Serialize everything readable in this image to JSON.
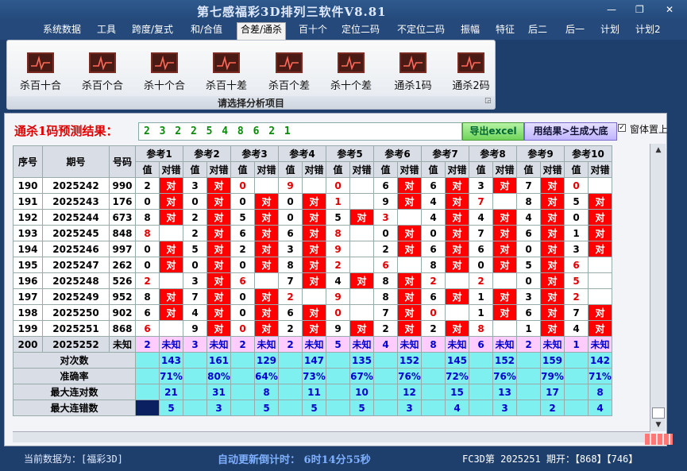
{
  "app": {
    "title": "第七感福彩3D排列三软件V8.81"
  },
  "menu": [
    "系统数据",
    "工具",
    "跨度/复式",
    "和/合值",
    "合差/通杀",
    "百十个",
    "定位二码",
    "不定位二码",
    "振幅",
    "特征",
    "后二",
    "后一",
    "计划",
    "计划2"
  ],
  "ribbon": {
    "buttons": [
      "杀百十合",
      "杀百个合",
      "杀十个合",
      "杀百十差",
      "杀百个差",
      "杀十个差",
      "通杀1码",
      "通杀2码"
    ],
    "caption": "请选择分析项目"
  },
  "prediction": {
    "label": "通杀1码预测结果：",
    "value": "2 3 2 2 5 4 8 6 2 1",
    "export_button": "导出excel",
    "result_button": "用结果>生成大底",
    "topmost_label": "窗体置上"
  },
  "table": {
    "headers": {
      "seq": "序号",
      "period": "期号",
      "number": "号码",
      "value": "值",
      "status": "对错"
    },
    "refs": [
      "参考1",
      "参考2",
      "参考3",
      "参考4",
      "参考5",
      "参考6",
      "参考7",
      "参考8",
      "参考9",
      "参考10"
    ],
    "hit_text": "对",
    "unknown_text": "未知",
    "rows": [
      {
        "seq": "190",
        "period": "2025242",
        "number": "990",
        "values": [
          "2",
          "3",
          "0",
          "9",
          "0",
          "6",
          "6",
          "3",
          "7",
          "0"
        ],
        "hits": [
          1,
          1,
          0,
          0,
          0,
          1,
          1,
          1,
          1,
          0
        ],
        "red": [
          0,
          0,
          1,
          1,
          1,
          0,
          0,
          0,
          0,
          1
        ]
      },
      {
        "seq": "191",
        "period": "2025243",
        "number": "176",
        "values": [
          "0",
          "0",
          "0",
          "0",
          "1",
          "9",
          "4",
          "7",
          "8",
          "5"
        ],
        "hits": [
          1,
          1,
          1,
          1,
          0,
          1,
          1,
          0,
          1,
          1
        ],
        "red": [
          0,
          0,
          0,
          0,
          1,
          0,
          0,
          1,
          0,
          0
        ]
      },
      {
        "seq": "192",
        "period": "2025244",
        "number": "673",
        "values": [
          "8",
          "2",
          "5",
          "0",
          "5",
          "3",
          "4",
          "4",
          "4",
          "0"
        ],
        "hits": [
          1,
          1,
          1,
          1,
          1,
          0,
          1,
          1,
          1,
          1
        ],
        "red": [
          0,
          0,
          0,
          0,
          0,
          1,
          0,
          0,
          0,
          0
        ]
      },
      {
        "seq": "193",
        "period": "2025245",
        "number": "848",
        "values": [
          "8",
          "2",
          "6",
          "6",
          "8",
          "0",
          "0",
          "7",
          "6",
          "1"
        ],
        "hits": [
          0,
          1,
          1,
          1,
          0,
          1,
          1,
          1,
          1,
          1
        ],
        "red": [
          1,
          0,
          0,
          0,
          1,
          0,
          0,
          0,
          0,
          0
        ]
      },
      {
        "seq": "194",
        "period": "2025246",
        "number": "997",
        "values": [
          "0",
          "5",
          "2",
          "3",
          "9",
          "2",
          "6",
          "6",
          "0",
          "3"
        ],
        "hits": [
          1,
          1,
          1,
          1,
          0,
          1,
          1,
          1,
          1,
          1
        ],
        "red": [
          0,
          0,
          0,
          0,
          1,
          0,
          0,
          0,
          0,
          0
        ]
      },
      {
        "seq": "195",
        "period": "2025247",
        "number": "262",
        "values": [
          "0",
          "0",
          "0",
          "8",
          "2",
          "6",
          "8",
          "0",
          "5",
          "6"
        ],
        "hits": [
          1,
          1,
          1,
          1,
          0,
          0,
          1,
          1,
          1,
          0
        ],
        "red": [
          0,
          0,
          0,
          0,
          1,
          1,
          0,
          0,
          0,
          1
        ]
      },
      {
        "seq": "196",
        "period": "2025248",
        "number": "526",
        "values": [
          "2",
          "3",
          "6",
          "7",
          "4",
          "8",
          "2",
          "2",
          "0",
          "5"
        ],
        "hits": [
          0,
          1,
          0,
          1,
          1,
          1,
          0,
          0,
          1,
          0
        ],
        "red": [
          1,
          0,
          1,
          0,
          0,
          0,
          1,
          1,
          0,
          1
        ]
      },
      {
        "seq": "197",
        "period": "2025249",
        "number": "952",
        "values": [
          "8",
          "7",
          "0",
          "2",
          "9",
          "8",
          "6",
          "1",
          "3",
          "2"
        ],
        "hits": [
          1,
          1,
          1,
          0,
          0,
          1,
          1,
          1,
          1,
          0
        ],
        "red": [
          0,
          0,
          0,
          1,
          1,
          0,
          0,
          0,
          0,
          1
        ]
      },
      {
        "seq": "198",
        "period": "2025250",
        "number": "902",
        "values": [
          "6",
          "4",
          "0",
          "6",
          "0",
          "7",
          "0",
          "1",
          "6",
          "7"
        ],
        "hits": [
          1,
          1,
          1,
          1,
          0,
          1,
          0,
          1,
          1,
          1
        ],
        "red": [
          0,
          0,
          0,
          0,
          1,
          0,
          1,
          0,
          0,
          0
        ]
      },
      {
        "seq": "199",
        "period": "2025251",
        "number": "868",
        "values": [
          "6",
          "9",
          "0",
          "2",
          "9",
          "2",
          "2",
          "8",
          "1",
          "4"
        ],
        "hits": [
          0,
          1,
          1,
          1,
          1,
          1,
          1,
          0,
          1,
          1
        ],
        "red": [
          1,
          0,
          1,
          0,
          0,
          0,
          0,
          1,
          0,
          0
        ]
      },
      {
        "seq": "200",
        "period": "2025252",
        "number": "未知",
        "values": [
          "2",
          "3",
          "2",
          "2",
          "5",
          "4",
          "8",
          "6",
          "2",
          "1"
        ],
        "hits": [
          0,
          0,
          0,
          0,
          0,
          0,
          0,
          0,
          0,
          0
        ],
        "red": [
          0,
          0,
          0,
          0,
          0,
          0,
          0,
          0,
          0,
          0
        ],
        "pred": true
      }
    ],
    "stats": [
      {
        "label": "对次数",
        "values": [
          "143",
          "161",
          "129",
          "147",
          "135",
          "152",
          "145",
          "152",
          "159",
          "142"
        ]
      },
      {
        "label": "准确率",
        "values": [
          "71%",
          "80%",
          "64%",
          "73%",
          "67%",
          "76%",
          "72%",
          "76%",
          "79%",
          "71%"
        ]
      },
      {
        "label": "最大连对数",
        "values": [
          "21",
          "31",
          "8",
          "11",
          "10",
          "12",
          "15",
          "13",
          "17",
          "8"
        ]
      },
      {
        "label": "最大连错数",
        "values": [
          "5",
          "3",
          "5",
          "5",
          "5",
          "3",
          "4",
          "3",
          "2",
          "4"
        ]
      }
    ]
  },
  "status": {
    "current_data": "当前数据为：[福彩3D]",
    "countdown": "自动更新倒计时：  6时14分55秒",
    "latest": "FC3D第 2025251 期开：【868】【746】"
  }
}
